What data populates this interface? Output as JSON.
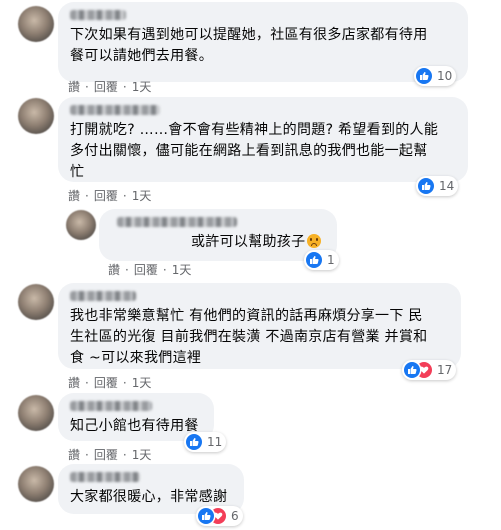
{
  "comments": [
    {
      "text": "下次如果有遇到她可以提醒她，社區有很多店家都有待用\n餐可以請她們去用餐。",
      "actions": {
        "like": "讚",
        "reply": "回覆",
        "time": "1天"
      },
      "reactions": {
        "count": "10",
        "types": [
          "like"
        ]
      }
    },
    {
      "text": "打開就吃? ……會不會有些精神上的問題? 希望看到的人能\n多付出關懷，儘可能在網路上看到訊息的我們也能一起幫\n忙",
      "actions": {
        "like": "讚",
        "reply": "回覆",
        "time": "1天"
      },
      "reactions": {
        "count": "14",
        "types": [
          "like"
        ]
      }
    },
    {
      "text": "或許可以幫助孩子",
      "actions": {
        "like": "讚",
        "reply": "回覆",
        "time": "1天"
      },
      "reactions": {
        "count": "1",
        "types": [
          "like"
        ]
      }
    },
    {
      "text": "我也非常樂意幫忙 有他們的資訊的話再麻煩分享一下 民\n生社區的光復 目前我們在裝潢 不過南京店有營業 并賞和\n食 ~可以來我們這裡",
      "actions": {
        "like": "讚",
        "reply": "回覆",
        "time": "1天"
      },
      "reactions": {
        "count": "17",
        "types": [
          "like",
          "love"
        ]
      }
    },
    {
      "text": "知己小館也有待用餐",
      "actions": {
        "like": "讚",
        "reply": "回覆",
        "time": "1天"
      },
      "reactions": {
        "count": "11",
        "types": [
          "like"
        ]
      }
    },
    {
      "text": "大家都很暖心，非常感謝",
      "actions": {
        "like": "讚",
        "reply": "回覆",
        "time": "1天"
      },
      "reactions": {
        "count": "6",
        "types": [
          "like",
          "love"
        ]
      }
    }
  ],
  "colors": {
    "bubble": "#f0f2f5",
    "like": "#1877f2",
    "love": "#f33e58",
    "meta": "#65676b"
  }
}
